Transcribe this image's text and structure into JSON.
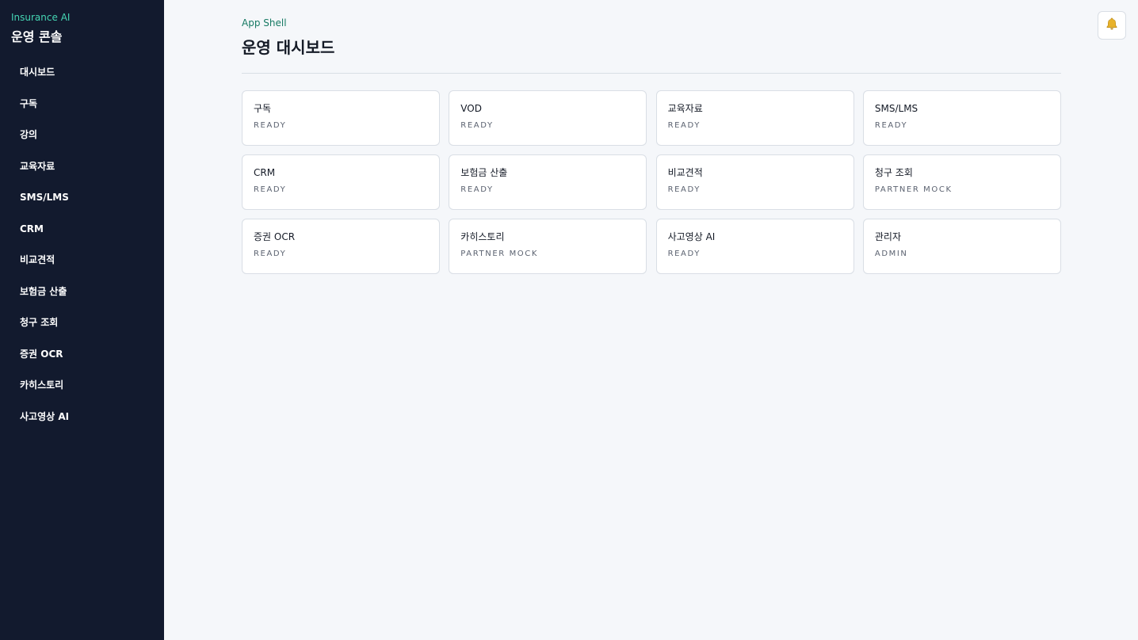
{
  "sidebar": {
    "brand_sub": "Insurance AI",
    "brand_title": "운영 콘솔",
    "items": [
      {
        "label": "대시보드"
      },
      {
        "label": "구독"
      },
      {
        "label": "강의"
      },
      {
        "label": "교육자료"
      },
      {
        "label": "SMS/LMS"
      },
      {
        "label": "CRM"
      },
      {
        "label": "비교견적"
      },
      {
        "label": "보험금 산출"
      },
      {
        "label": "청구 조회"
      },
      {
        "label": "증권 OCR"
      },
      {
        "label": "카히스토리"
      },
      {
        "label": "사고영상 AI"
      }
    ]
  },
  "header": {
    "breadcrumb": "App Shell",
    "title": "운영 대시보드",
    "notification_icon": "bell-icon"
  },
  "cards": [
    {
      "title": "구독",
      "status": "READY"
    },
    {
      "title": "VOD",
      "status": "READY"
    },
    {
      "title": "교육자료",
      "status": "READY"
    },
    {
      "title": "SMS/LMS",
      "status": "READY"
    },
    {
      "title": "CRM",
      "status": "READY"
    },
    {
      "title": "보험금 산출",
      "status": "READY"
    },
    {
      "title": "비교견적",
      "status": "READY"
    },
    {
      "title": "청구 조회",
      "status": "PARTNER MOCK"
    },
    {
      "title": "증권 OCR",
      "status": "READY"
    },
    {
      "title": "카히스토리",
      "status": "PARTNER MOCK"
    },
    {
      "title": "사고영상 AI",
      "status": "READY"
    },
    {
      "title": "관리자",
      "status": "ADMIN"
    }
  ],
  "colors": {
    "sidebar_bg": "#121a2e",
    "accent": "#45d6b4",
    "breadcrumb": "#177a64",
    "page_bg": "#f5f7fa",
    "bell": "#e8b22a"
  }
}
